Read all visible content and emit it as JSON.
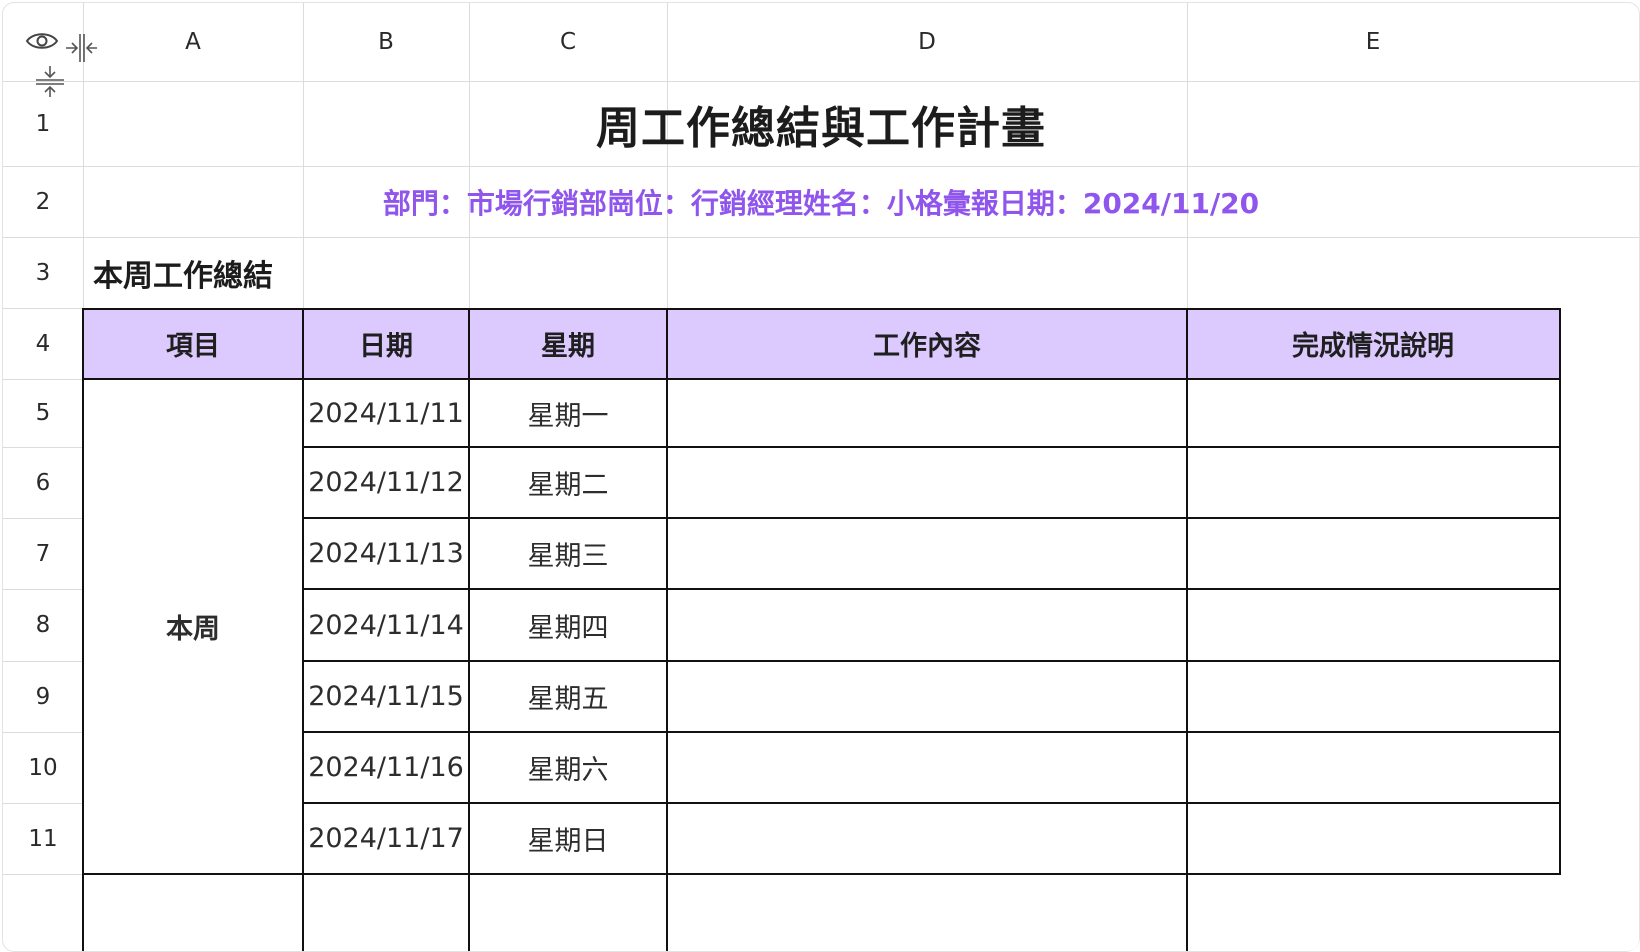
{
  "columns": [
    "A",
    "B",
    "C",
    "D",
    "E"
  ],
  "rows": [
    "1",
    "2",
    "3",
    "4",
    "5",
    "6",
    "7",
    "8",
    "9",
    "10",
    "11"
  ],
  "title": "周工作總結與工作計畫",
  "subtitle": "部門：市場行銷部崗位：行銷經理姓名：小格彙報日期：2024/11/20",
  "section_title": "本周工作總結",
  "table": {
    "headers": [
      "項目",
      "日期",
      "星期",
      "工作內容",
      "完成情況說明"
    ],
    "group_label": "本周",
    "rows": [
      {
        "date": "2024/11/11",
        "weekday": "星期一",
        "content": "",
        "status": ""
      },
      {
        "date": "2024/11/12",
        "weekday": "星期二",
        "content": "",
        "status": ""
      },
      {
        "date": "2024/11/13",
        "weekday": "星期三",
        "content": "",
        "status": ""
      },
      {
        "date": "2024/11/14",
        "weekday": "星期四",
        "content": "",
        "status": ""
      },
      {
        "date": "2024/11/15",
        "weekday": "星期五",
        "content": "",
        "status": ""
      },
      {
        "date": "2024/11/16",
        "weekday": "星期六",
        "content": "",
        "status": ""
      },
      {
        "date": "2024/11/17",
        "weekday": "星期日",
        "content": "",
        "status": ""
      }
    ]
  },
  "icons": [
    "eye-icon",
    "collapse-columns-icon",
    "collapse-rows-icon"
  ],
  "colors": {
    "header_fill": "#dccaff",
    "subtitle_text": "#8f55ec",
    "grid": "#dcdcdc",
    "border": "#111111"
  }
}
